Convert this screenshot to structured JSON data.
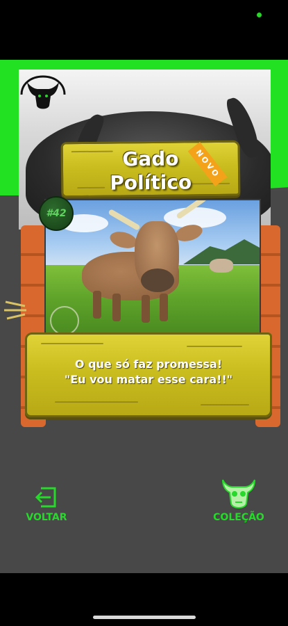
{
  "card": {
    "title": "Gado\nPolítico",
    "badge_new": "NOVO",
    "number": "#42",
    "description_line1": "O que só faz promessa!",
    "description_line2": "\"Eu vou matar esse cara!!\""
  },
  "nav": {
    "back_label": "VOLTAR",
    "back_icon": "exit-arrow-icon",
    "collection_label": "COLEÇÃO",
    "collection_icon": "cow-skull-icon"
  },
  "colors": {
    "accent_green": "#27d92b",
    "wood_yellow": "#d6c92a",
    "wood_orange": "#d8682e",
    "badge_orange": "#f5a21b",
    "background_gray": "#4a4a4a"
  }
}
